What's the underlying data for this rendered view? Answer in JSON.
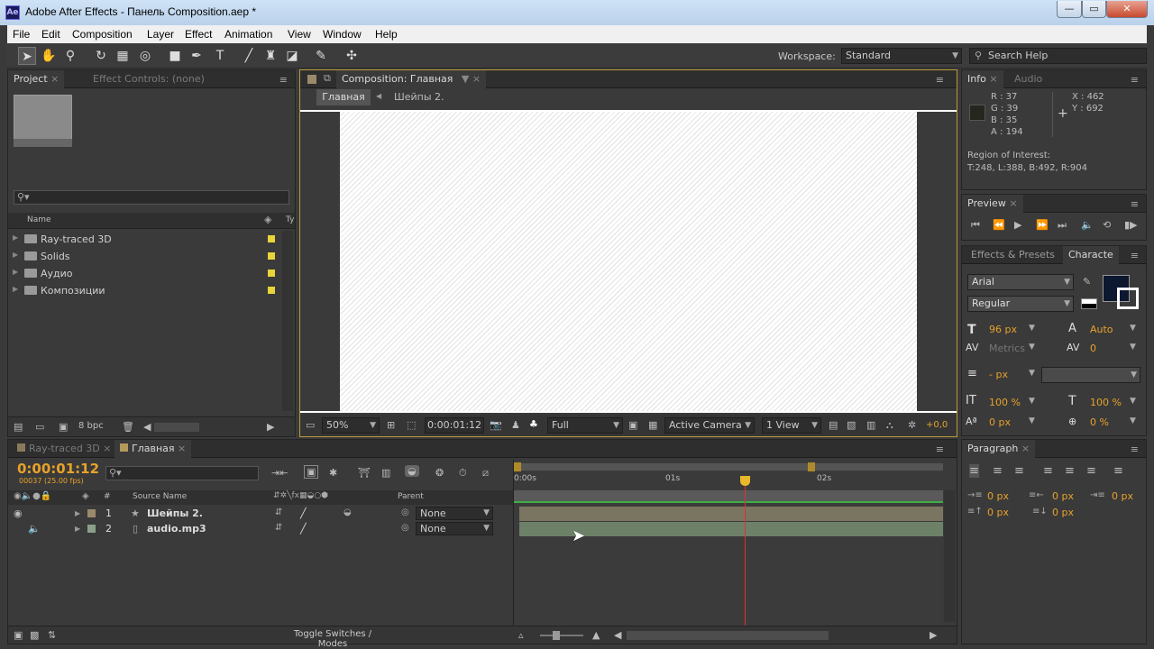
{
  "window": {
    "title": "Adobe After Effects - Панель Composition.aep *",
    "app_icon": "Ae"
  },
  "menu": [
    "File",
    "Edit",
    "Composition",
    "Layer",
    "Effect",
    "Animation",
    "View",
    "Window",
    "Help"
  ],
  "toolbar": {
    "workspace_label": "Workspace:",
    "workspace_value": "Standard",
    "search_placeholder": "Search Help"
  },
  "project": {
    "tab_project": "Project",
    "tab_effect_controls": "Effect Controls: (none)",
    "col_name": "Name",
    "col_type": "Ty",
    "items": [
      {
        "name": "Ray-traced 3D"
      },
      {
        "name": "Solids"
      },
      {
        "name": "Аудио"
      },
      {
        "name": "Композиции"
      }
    ],
    "bpc": "8 bpc",
    "label_color": "#e8d43a"
  },
  "composition": {
    "tab": "Composition: Главная",
    "breadcrumb_active": "Главная",
    "breadcrumb_other": "Шейпы 2.",
    "zoom": "50%",
    "timecode": "0:00:01:12",
    "resolution": "Full",
    "camera": "Active Camera",
    "views": "1 View",
    "exposure": "+0,0"
  },
  "info": {
    "tab_info": "Info",
    "tab_audio": "Audio",
    "r": "R : 37",
    "g": "G : 39",
    "b": "B : 35",
    "a": "A : 194",
    "x": "X : 462",
    "y": "Y : 692",
    "roi_label": "Region of Interest:",
    "roi_value": "T:248, L:388, B:492, R:904"
  },
  "preview": {
    "tab": "Preview"
  },
  "character": {
    "tab_effects": "Effects & Presets",
    "tab_character": "Characte",
    "font": "Arial",
    "style": "Regular",
    "size": "96 px",
    "leading": "Auto",
    "kerning": "Metrics",
    "tracking": "0",
    "stroke": "- px",
    "vscale": "100 %",
    "hscale": "100 %",
    "baseline": "0 px",
    "tsume": "0 %"
  },
  "paragraph": {
    "tab": "Paragraph",
    "indent_left": "0 px",
    "indent_right": "0 px",
    "indent_first": "0 px",
    "space_before": "0 px",
    "space_after": "0 px"
  },
  "timeline": {
    "tab_inactive": "Ray-traced 3D",
    "tab_active": "Главная",
    "timecode": "0:00:01:12",
    "frames": "00037 (25.00 fps)",
    "col_hash": "#",
    "col_source": "Source Name",
    "col_parent": "Parent",
    "ruler": [
      "0:00s",
      "01s",
      "02s"
    ],
    "layers": [
      {
        "num": "1",
        "name": "Шейпы 2.",
        "parent": "None"
      },
      {
        "num": "2",
        "name": "audio.mp3",
        "parent": "None"
      }
    ],
    "toggle_label": "Toggle Switches / Modes"
  },
  "colors": {
    "accent": "#e8a22a",
    "playhead": "#e03030",
    "track_green": "#5f7a55"
  }
}
